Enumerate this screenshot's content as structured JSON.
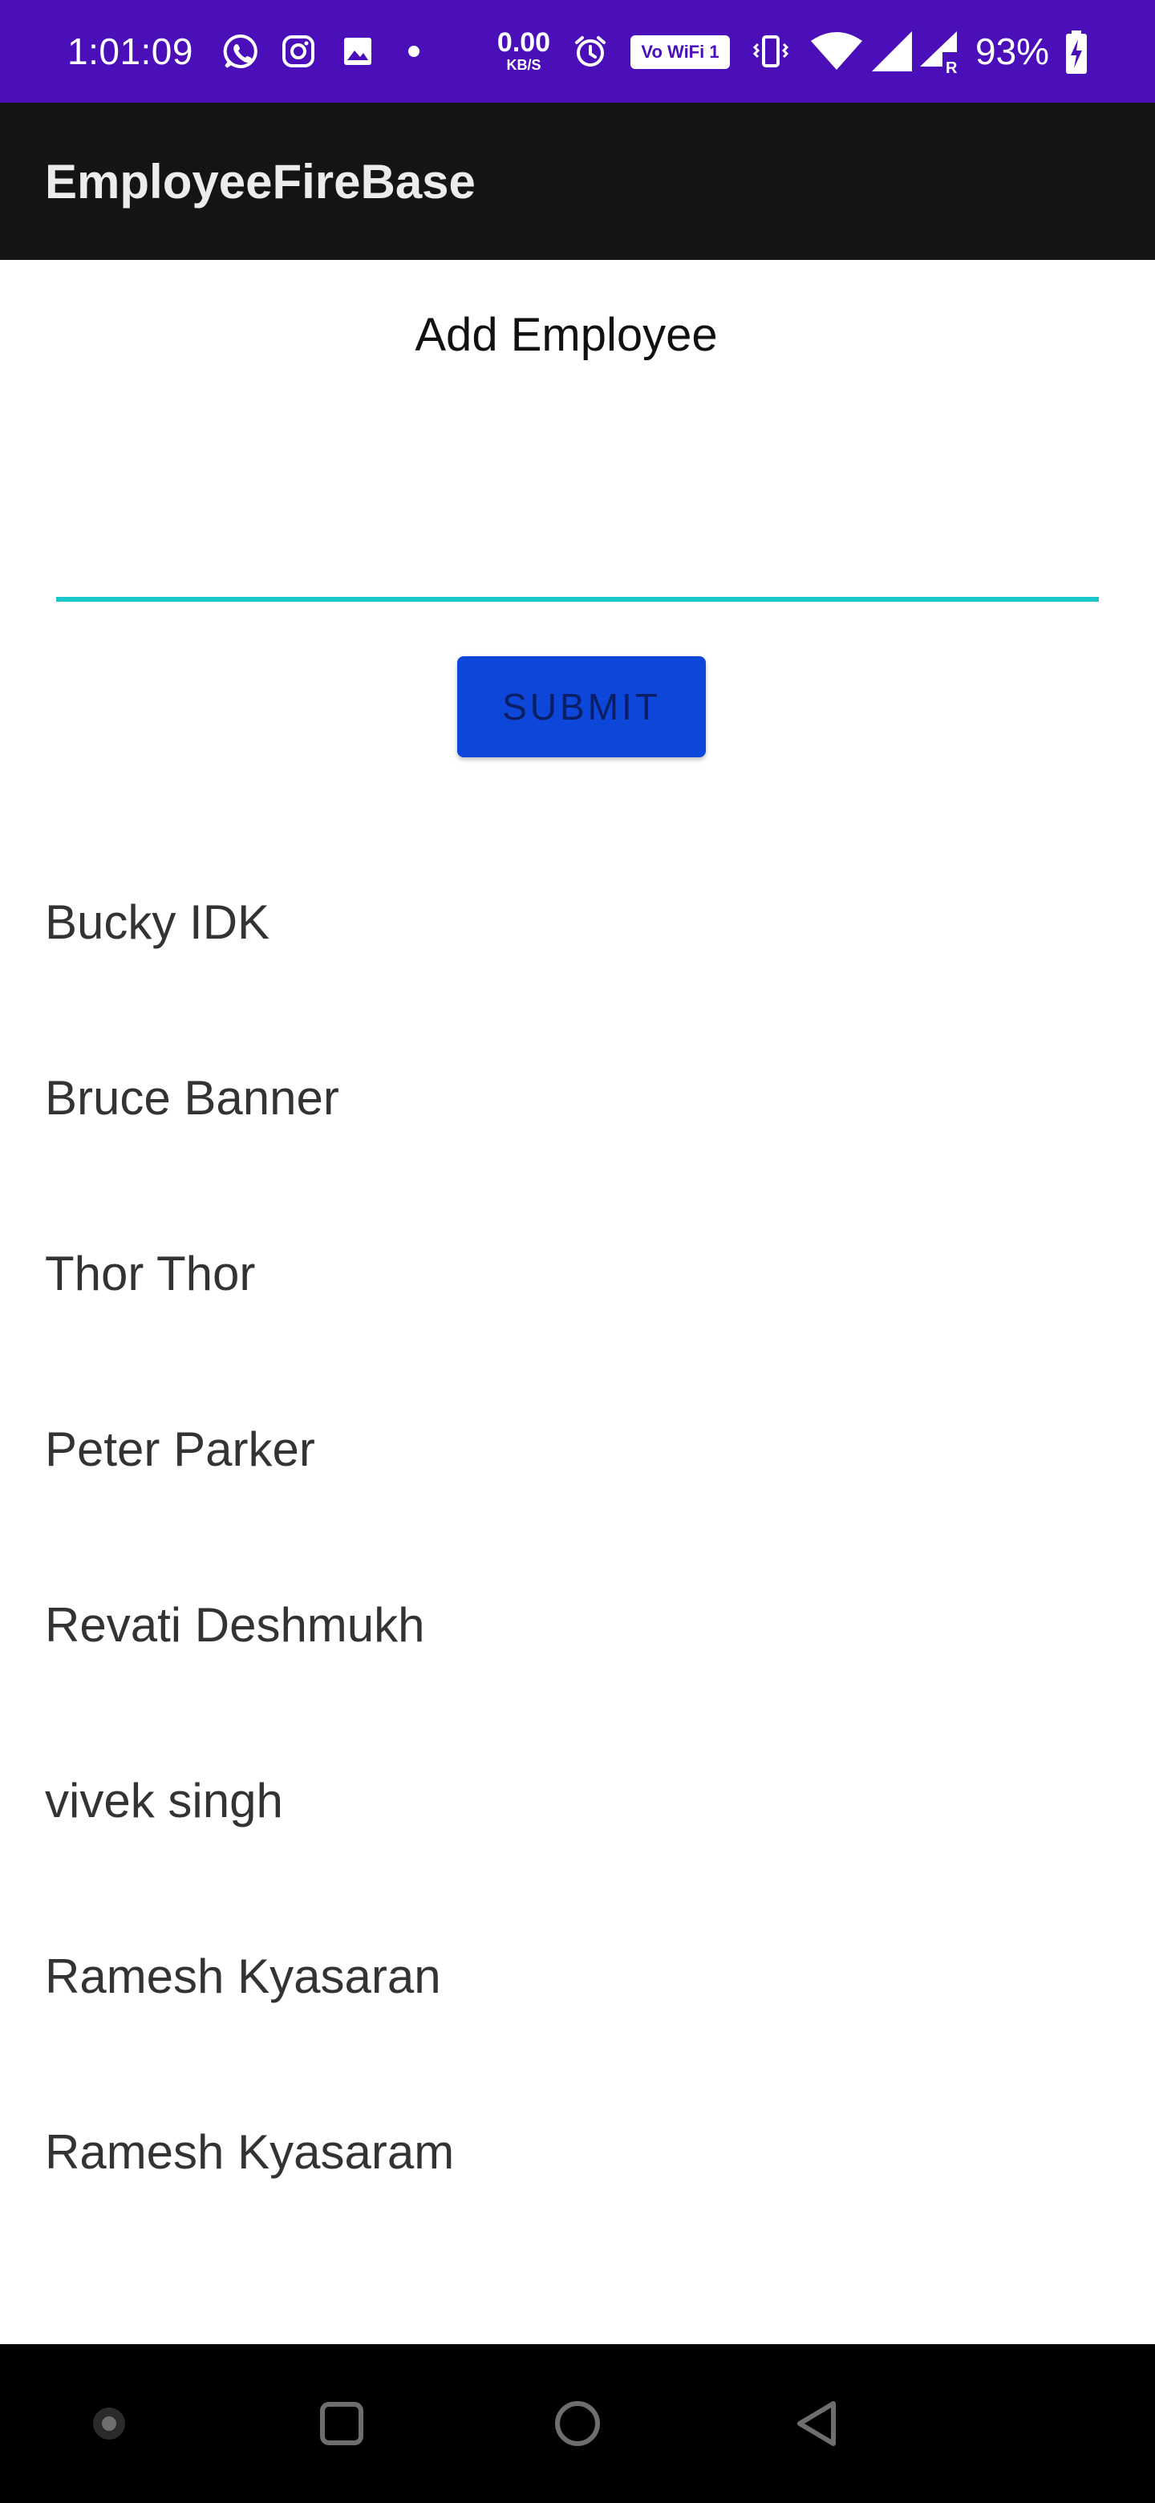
{
  "status_bar": {
    "time": "1:01:09",
    "net_speed": "0.00",
    "net_unit": "KB/S",
    "wifi_badge": "Vo WiFi 1",
    "battery_percent": "93%",
    "icons": [
      "whatsapp-icon",
      "instagram-icon",
      "gallery-icon",
      "notification-dot-icon",
      "alarm-icon",
      "vibrate-icon",
      "wifi-icon",
      "signal-icon",
      "signal-roaming-icon",
      "battery-charging-icon"
    ]
  },
  "app_bar": {
    "title": "EmployeeFireBase"
  },
  "form": {
    "heading": "Add Employee",
    "input_value": "",
    "input_placeholder": "",
    "submit_label": "SUBMIT"
  },
  "employees": [
    "Bucky IDK",
    "Bruce Banner",
    "Thor Thor",
    "Peter Parker",
    "Revati Deshmukh",
    "vivek singh",
    "Ramesh Kyasaran",
    "Ramesh Kyasaram"
  ],
  "nav_bar": {
    "buttons": [
      "menu-dot-icon",
      "recents-icon",
      "home-icon",
      "back-icon"
    ]
  },
  "colors": {
    "status_bar": "#4a0fb8",
    "app_bar": "#141414",
    "input_underline": "#19c8c8",
    "submit_button": "#0d47d9",
    "submit_text": "#0a1e66",
    "nav_bar": "#000000"
  }
}
